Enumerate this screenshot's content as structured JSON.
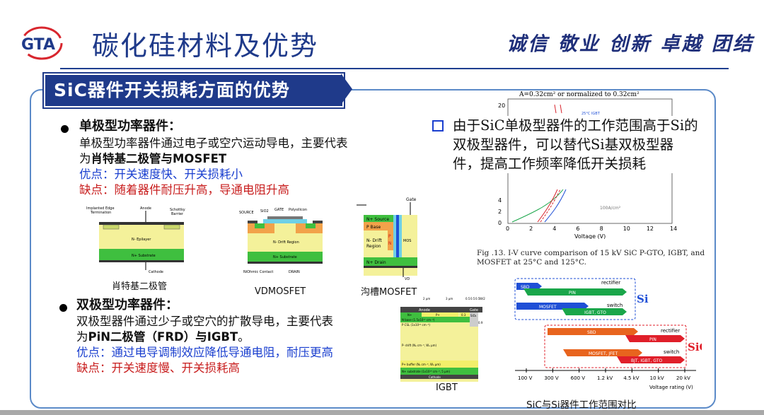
{
  "header": {
    "logo_text": "GTA",
    "title": "碳化硅材料及优势",
    "motto": "诚信 敬业 创新 卓越 团结"
  },
  "section": {
    "title": "SiC器件开关损耗方面的优势"
  },
  "unipolar": {
    "heading": "单极型功率器件：",
    "line1": "单极型功率器件通过电子或空穴运动导电，主要代表",
    "line2_prefix": "为",
    "line2_bold": "肖特基二极管与MOSFET",
    "pro": "优点：开关速度快、开关损耗小",
    "con": "缺点：随着器件耐压升高，导通电阻升高"
  },
  "bipolar": {
    "heading": "双极型功率器件：",
    "line1": "双极型器件通过少子或空穴的扩散导电，主要代表",
    "line2_prefix": "为",
    "line2_bold": "PiN二极管（FRD）与IGBT",
    "line2_suffix": "。",
    "pro": "优点：通过电导调制效应降低导通电阻，耐压更高",
    "con": "缺点：开关速度慢、开关损耗高"
  },
  "diagrams": {
    "schottky": {
      "caption": "肖特基二极管",
      "labels": {
        "edge": "Implanted Edge",
        "edge2": "Termination",
        "anode": "Anode",
        "barrier": "Schottky",
        "barrier2": "Barrier",
        "epi": "N- Epilayer",
        "sub": "N+ Substrate",
        "cathode": "Cathode"
      }
    },
    "vdmosfet": {
      "caption": "VDMOSFET",
      "labels": {
        "source": "SOURCE",
        "sio2": "SiO2",
        "gate": "GATE",
        "poly": "Polysilicon",
        "drift": "N- Drift Region",
        "sub": "N+ Substrate",
        "ohmic": "NiOhmic Contact",
        "drain": "DRAIN"
      }
    },
    "trench": {
      "caption": "沟槽MOSFET",
      "labels": {
        "gate": "Gate",
        "source": "N+ Source",
        "base": "P Base",
        "drift": "N- Drift",
        "region": "Region",
        "p": "P",
        "n": "N",
        "mos": "MOS",
        "drain": "N+ Drain",
        "vd": "VD"
      }
    },
    "igbt": {
      "caption": "IGBT",
      "labels": {
        "anode": "Anode",
        "gate": "Gate",
        "n": "N+",
        "p": "P+",
        "nbase": "N base (1.5x10¹⁷ cm⁻³)",
        "pcsl": "P CSL (1x10¹⁶ cm⁻³)",
        "drift": "P- drift (Nₐ cm⁻³, Wₐ μm)",
        "buffer": "P+ buffer (Nₐ cm⁻³, Wₐ μm)",
        "substrate": "N+ substrate (1x10¹⁹ cm⁻³, 5 μm)",
        "cathode": "Cathode",
        "d1": "2 μm",
        "d2": "3 μm",
        "d3": "0.5",
        "d4": "0.5",
        "d5": "0.5",
        "d6": "W/2",
        "sio2": "SiO₂",
        "v03": "0.3",
        "v09": "0.9"
      }
    }
  },
  "right": {
    "statement": "由于SiC单极型器件的工作范围高于Si的双极型器件，可以替代Si基双极型器件，提高工作频率降低开关损耗"
  },
  "chart_data": {
    "type": "line",
    "title": "A=0.32cm² or normalized to 0.32cm²",
    "xlabel": "Voltage (V)",
    "ylabel": "",
    "xlim": [
      0,
      14
    ],
    "xticks": [
      "0",
      "2",
      "4",
      "6",
      "8",
      "10",
      "12",
      "14"
    ],
    "yticks_visible": [
      "20",
      "4",
      "2",
      "0"
    ],
    "annotations": [
      "25°C IGBT",
      "100A/cm²"
    ],
    "caption_line1": "Fig .13. I-V curve comparison of 15 kV SiC P-GTO, IGBT, and",
    "caption_line2": "MOSFET at 25°C and 125°C."
  },
  "range_chart": {
    "caption": "SiC与Si器件工作范围对比",
    "axis_label": "Voltage rating (V)",
    "ticks": [
      "100 V",
      "300 V",
      "600 V",
      "1.2 kV",
      "4.5 kV",
      "10 kV",
      "20 kV"
    ],
    "si": {
      "label": "Si",
      "rectifier": "rectifier",
      "switch": "switch",
      "sbd": "SBD",
      "pin": "PIN",
      "mosfet": "MOSFET",
      "igbt": "IGBT, GTO"
    },
    "sic": {
      "label": "SiC",
      "rectifier": "rectifier",
      "switch": "switch",
      "sbd": "SBD",
      "pin": "PIN",
      "mosfet": "MOSFET, JFET",
      "bjt": "BJT, IGBT, GTO"
    },
    "colors": {
      "si_blue": "#1f4fd6",
      "si_green": "#1aa64a",
      "sic_orange": "#e8641e",
      "sic_red": "#e01f2a"
    }
  }
}
